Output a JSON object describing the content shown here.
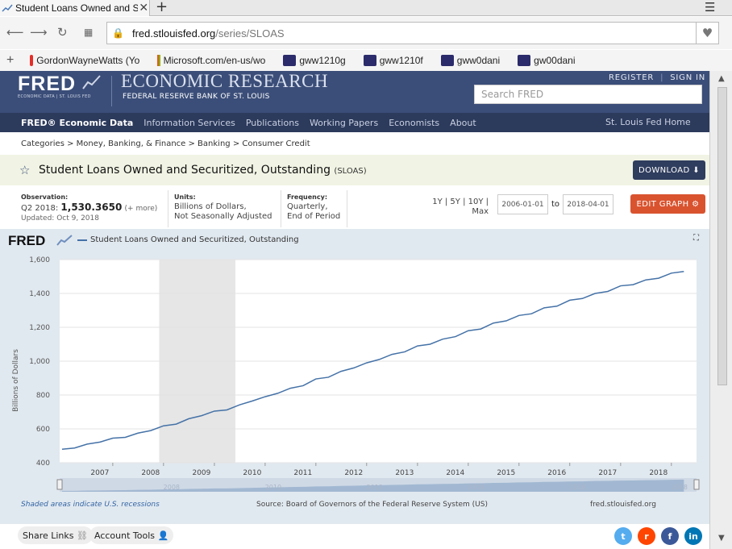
{
  "browser": {
    "tab_title": "Student Loans Owned and Se",
    "tab_close": "✕",
    "new_tab": "+",
    "menu_icon": "☰",
    "url_host": "fred.stlouisfed.org",
    "url_path": "/series/SLOAS",
    "bookmarks": [
      {
        "label": "GordonWayneWatts (Yo",
        "icon": "youtube-icon",
        "color": "#e52d27"
      },
      {
        "label": "Microsoft.com/en-us/wo",
        "icon": "microsoft-icon",
        "color": "#f25022"
      },
      {
        "label": "gww1210g",
        "icon": "bookmark-icon",
        "color": "#2b2b6b"
      },
      {
        "label": "gww1210f",
        "icon": "bookmark-icon",
        "color": "#2b2b6b"
      },
      {
        "label": "gww0dani",
        "icon": "bookmark-icon",
        "color": "#2b2b6b"
      },
      {
        "label": "gw00dani",
        "icon": "bookmark-icon",
        "color": "#2b2b6b"
      }
    ]
  },
  "header": {
    "logo": "FRED",
    "logo_sub": "ECONOMIC DATA | ST. LOUIS FED",
    "econ_research": "ECONOMIC RESEARCH",
    "frb": "FEDERAL RESERVE BANK OF ST. LOUIS",
    "register": "REGISTER",
    "sign_in": "SIGN IN",
    "search_placeholder": "Search FRED"
  },
  "nav": {
    "items": [
      "FRED® Economic Data",
      "Information Services",
      "Publications",
      "Working Papers",
      "Economists",
      "About"
    ],
    "right": "St. Louis Fed Home"
  },
  "breadcrumb": "Categories > Money, Banking, & Finance > Banking > Consumer Credit",
  "series": {
    "title": "Student Loans Owned and Securitized, Outstanding",
    "code": "(SLOAS)",
    "download_label": "DOWNLOAD"
  },
  "meta": {
    "obs_label": "Observation:",
    "obs_period": "Q2 2018:",
    "obs_value": "1,530.3650",
    "obs_more": "(+ more)",
    "updated": "Updated: Oct 9, 2018",
    "units_label": "Units:",
    "units_1": "Billions of Dollars,",
    "units_2": "Not Seasonally Adjusted",
    "freq_label": "Frequency:",
    "freq_1": "Quarterly,",
    "freq_2": "End of Period",
    "range_1": "1Y | 5Y | 10Y |",
    "range_2": "Max",
    "date_from": "2006-01-01",
    "to": "to",
    "date_to": "2018-04-01",
    "edit_label": "EDIT GRAPH"
  },
  "graph": {
    "fred_logo": "FRED",
    "legend": "Student Loans Owned and Securitized, Outstanding",
    "expand_icon": "⛶",
    "recession_note": "Shaded areas indicate U.S. recessions",
    "source": "Source: Board of Governors of the Federal Reserve System (US)",
    "site": "fred.stlouisfed.org"
  },
  "footer": {
    "share_links": "Share Links",
    "account_tools": "Account Tools",
    "social": [
      {
        "name": "twitter-icon",
        "glyph": "t",
        "color": "#55acee"
      },
      {
        "name": "reddit-icon",
        "glyph": "r",
        "color": "#ff4500"
      },
      {
        "name": "facebook-icon",
        "glyph": "f",
        "color": "#3b5998"
      },
      {
        "name": "linkedin-icon",
        "glyph": "in",
        "color": "#0077b5"
      }
    ]
  },
  "chart_data": {
    "type": "line",
    "title": "",
    "series": [
      {
        "name": "Student Loans Owned and Securitized, Outstanding"
      }
    ],
    "ylabel": "Billions of Dollars",
    "xlabel": "",
    "ylim": [
      400,
      1600
    ],
    "yticks": [
      400,
      600,
      800,
      1000,
      1200,
      1400,
      1600
    ],
    "xticks": [
      "2007",
      "2008",
      "2009",
      "2010",
      "2011",
      "2012",
      "2013",
      "2014",
      "2015",
      "2016",
      "2017",
      "2018"
    ],
    "recession": [
      "2007-12-01",
      "2009-06-01"
    ],
    "navigator_labels": [
      "2008",
      "2010",
      "2012",
      "2014",
      "2016",
      "2018"
    ],
    "x": [
      "2006-01-01",
      "2006-04-01",
      "2006-07-01",
      "2006-10-01",
      "2007-01-01",
      "2007-04-01",
      "2007-07-01",
      "2007-10-01",
      "2008-01-01",
      "2008-04-01",
      "2008-07-01",
      "2008-10-01",
      "2009-01-01",
      "2009-04-01",
      "2009-07-01",
      "2009-10-01",
      "2010-01-01",
      "2010-04-01",
      "2010-07-01",
      "2010-10-01",
      "2011-01-01",
      "2011-04-01",
      "2011-07-01",
      "2011-10-01",
      "2012-01-01",
      "2012-04-01",
      "2012-07-01",
      "2012-10-01",
      "2013-01-01",
      "2013-04-01",
      "2013-07-01",
      "2013-10-01",
      "2014-01-01",
      "2014-04-01",
      "2014-07-01",
      "2014-10-01",
      "2015-01-01",
      "2015-04-01",
      "2015-07-01",
      "2015-10-01",
      "2016-01-01",
      "2016-04-01",
      "2016-07-01",
      "2016-10-01",
      "2017-01-01",
      "2017-04-01",
      "2017-07-01",
      "2017-10-01",
      "2018-01-01",
      "2018-04-01"
    ],
    "values": [
      480,
      487,
      510,
      522,
      545,
      550,
      575,
      590,
      618,
      628,
      660,
      678,
      705,
      712,
      742,
      765,
      790,
      810,
      840,
      855,
      895,
      905,
      940,
      960,
      990,
      1010,
      1040,
      1055,
      1090,
      1100,
      1130,
      1145,
      1180,
      1190,
      1225,
      1238,
      1270,
      1280,
      1315,
      1325,
      1360,
      1370,
      1400,
      1412,
      1445,
      1452,
      1480,
      1490,
      1520,
      1530
    ]
  }
}
